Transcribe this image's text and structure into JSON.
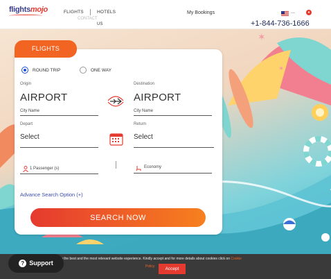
{
  "header": {
    "logo_text_a": "flights",
    "logo_text_b": "mojo",
    "nav_flights": "FLIGHTS",
    "nav_hotels": "HOTELS",
    "nav_contact_a": "CONTACT",
    "nav_contact_b": "US",
    "my_bookings": "My Bookings",
    "flag_suffix": "...",
    "phone": "+1-844-736-1666"
  },
  "search": {
    "tab_label": "FLIGHTS",
    "trip_types": [
      {
        "label": "ROUND TRIP",
        "selected": true
      },
      {
        "label": "ONE WAY",
        "selected": false
      }
    ],
    "origin_label": "Origin",
    "origin_value": "AIRPORT",
    "origin_sub": "City Name",
    "destination_label": "Destination",
    "destination_value": "AIRPORT",
    "destination_sub": "City Name",
    "depart_label": "Depart",
    "depart_value": "Select",
    "return_label": "Return",
    "return_value": "Select",
    "passengers": "1 Passenger (s)",
    "cabin": "Economy",
    "advance_option": "Advance Search Option (+)",
    "search_button": "SEARCH NOW"
  },
  "cookie": {
    "text": "ve you the best and the most relevant website experience. Kindly accept and for more details about cookies click on",
    "link": "Cookie",
    "more": "Policy",
    "accept": "Accept"
  },
  "support": {
    "label": "Support"
  },
  "colors": {
    "brand_orange": "#f26422",
    "brand_red": "#e53a2f",
    "brand_navy": "#3b3f8f"
  }
}
